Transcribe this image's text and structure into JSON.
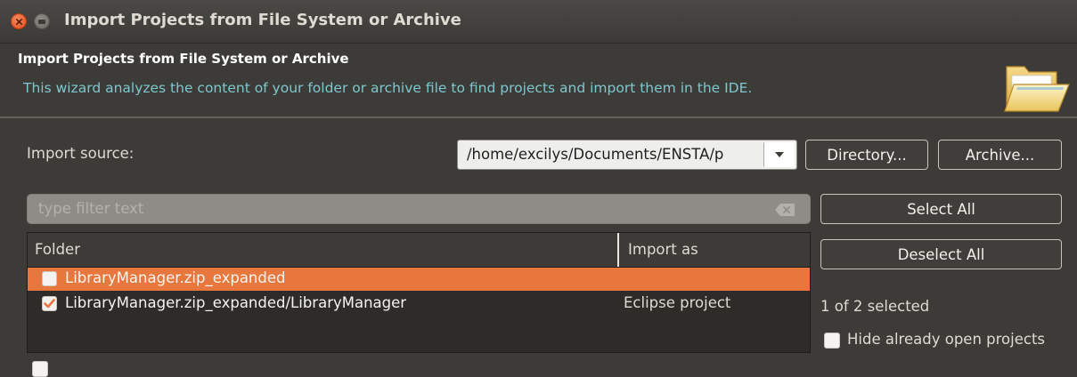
{
  "window": {
    "title": "Import Projects from File System or Archive"
  },
  "header": {
    "title": "Import Projects from File System or Archive",
    "description": "This wizard analyzes the content of your folder or archive file to find projects and import them in the IDE.",
    "icon": "folder-open-icon"
  },
  "source": {
    "label": "Import source:",
    "value": "/home/excilys/Documents/ENSTA/p",
    "directory_button": "Directory...",
    "archive_button": "Archive..."
  },
  "filter": {
    "placeholder": "type filter text"
  },
  "table": {
    "columns": [
      "Folder",
      "Import as"
    ],
    "rows": [
      {
        "folder": "LibraryManager.zip_expanded",
        "import_as": "",
        "checked": false,
        "selected": true
      },
      {
        "folder": "LibraryManager.zip_expanded/LibraryManager",
        "import_as": "Eclipse project",
        "checked": true,
        "selected": false
      }
    ]
  },
  "actions": {
    "select_all": "Select All",
    "deselect_all": "Deselect All",
    "selected_count": "1 of 2 selected",
    "hide_open_label": "Hide already open projects"
  },
  "colors": {
    "accent": "#e8773d",
    "close_button": "#df4b16",
    "description_text": "#7ec7cf",
    "background": "#3c3b37"
  }
}
